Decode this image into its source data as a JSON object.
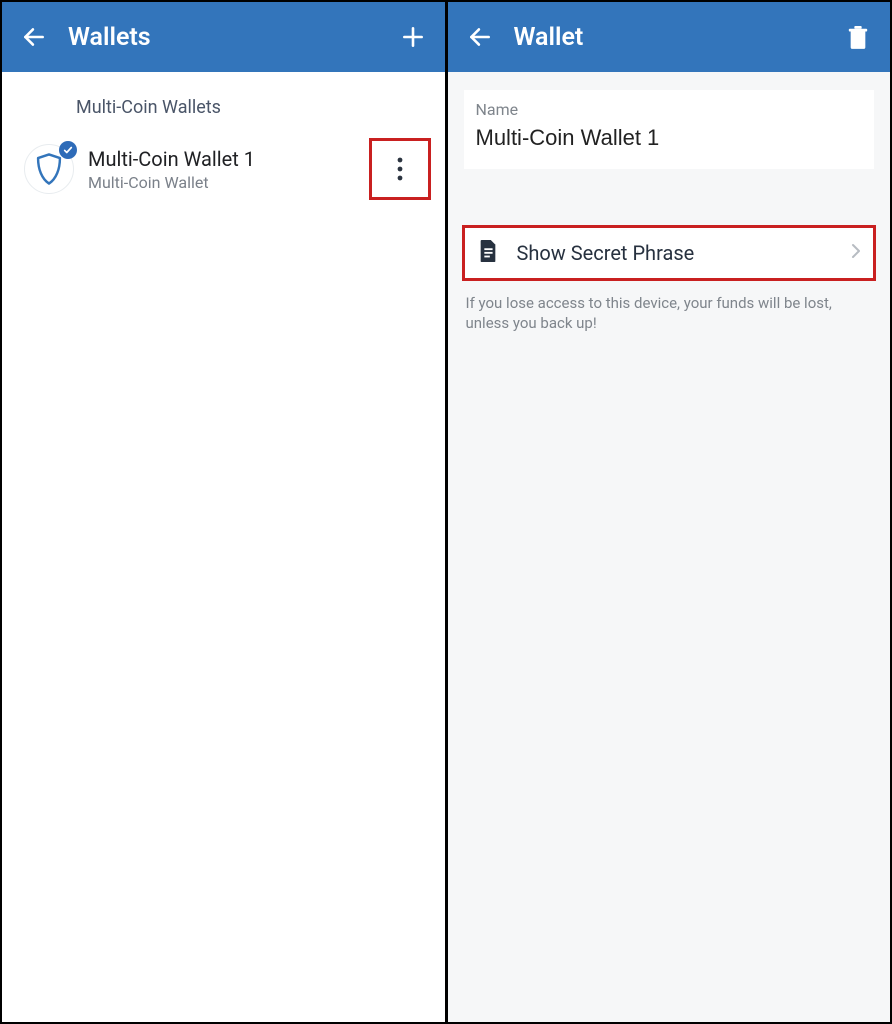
{
  "left": {
    "title": "Wallets",
    "section_label": "Multi-Coin Wallets",
    "wallet": {
      "name": "Multi-Coin Wallet 1",
      "subtitle": "Multi-Coin Wallet"
    }
  },
  "right": {
    "title": "Wallet",
    "name_label": "Name",
    "name_value": "Multi-Coin Wallet 1",
    "secret_label": "Show Secret Phrase",
    "secret_note": "If you lose access to this device, your funds will be lost, unless you back up!"
  },
  "colors": {
    "primary": "#3375bb",
    "highlight": "#c92020"
  }
}
